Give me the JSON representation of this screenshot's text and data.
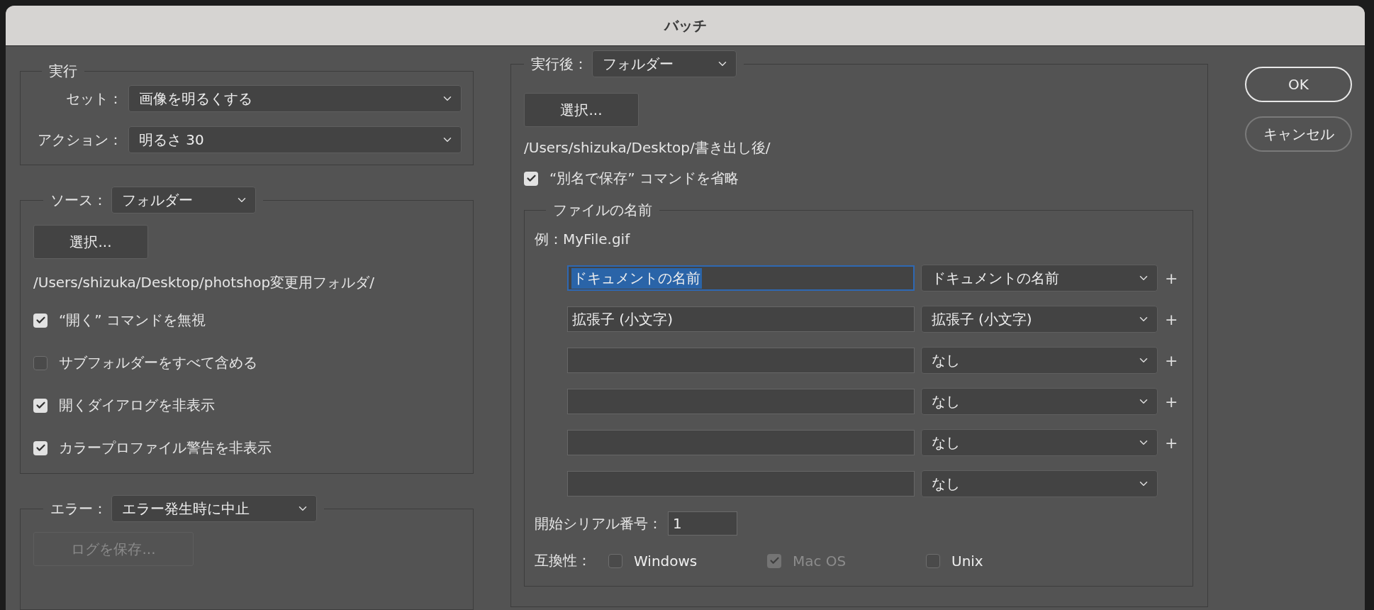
{
  "window": {
    "title": "バッチ"
  },
  "play": {
    "legend": "実行",
    "set": {
      "label": "セット：",
      "value": "画像を明るくする"
    },
    "action": {
      "label": "アクション：",
      "value": "明るさ 30"
    }
  },
  "source": {
    "label": "ソース：",
    "value": "フォルダー",
    "choose_button": "選択...",
    "path": "/Users/shizuka/Desktop/photshop変更用フォルダ/",
    "options": [
      {
        "label": "“開く” コマンドを無視",
        "checked": true
      },
      {
        "label": "サブフォルダーをすべて含める",
        "checked": false
      },
      {
        "label": "開くダイアログを非表示",
        "checked": true
      },
      {
        "label": "カラープロファイル警告を非表示",
        "checked": true
      }
    ]
  },
  "error": {
    "label": "エラー：",
    "value": "エラー発生時に中止",
    "log_button": {
      "label": "ログを保存...",
      "disabled": true
    }
  },
  "destination": {
    "label": "実行後：",
    "value": "フォルダー",
    "choose_button": "選択...",
    "path": "/Users/shizuka/Desktop/書き出し後/",
    "override": {
      "label": "“別名で保存” コマンドを省略",
      "checked": true
    },
    "file_naming": {
      "legend": "ファイルの名前",
      "example": "例：MyFile.gif",
      "rows": [
        {
          "text": "ドキュメントの名前",
          "focused": true,
          "option": "ドキュメントの名前",
          "add": "+"
        },
        {
          "text": "拡張子 (小文字)",
          "focused": false,
          "option": "拡張子 (小文字)",
          "add": "+"
        },
        {
          "focused": false,
          "option": "なし",
          "add": "+"
        },
        {
          "focused": false,
          "option": "なし",
          "add": "+"
        },
        {
          "focused": false,
          "option": "なし",
          "add": "+"
        },
        {
          "focused": false,
          "option": "なし"
        }
      ],
      "serial": {
        "label": "開始シリアル番号：",
        "value": "1"
      },
      "compatibility": {
        "label": "互換性：",
        "options": [
          {
            "label": "Windows",
            "checked": false,
            "disabled": false
          },
          {
            "label": "Mac OS",
            "checked": true,
            "disabled": true
          },
          {
            "label": "Unix",
            "checked": false,
            "disabled": false
          }
        ]
      }
    }
  },
  "buttons": [
    {
      "label": "OK",
      "default": true
    },
    {
      "label": "キャンセル",
      "default": false
    }
  ]
}
